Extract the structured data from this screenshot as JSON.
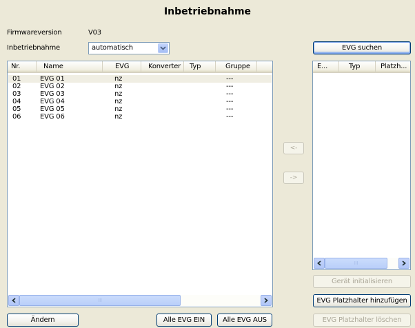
{
  "window": {
    "title": "Inbetriebnahme"
  },
  "firmware": {
    "label": "Firmwareversion",
    "value": "V03"
  },
  "commissioning": {
    "label": "Inbetriebnahme",
    "selected": "automatisch"
  },
  "main_list": {
    "columns": [
      "Nr.",
      "Name",
      "EVG",
      "Konverter",
      "Typ",
      "Gruppe"
    ],
    "rows": [
      {
        "nr": "01",
        "name": "EVG 01",
        "evg": "nz",
        "konverter": "",
        "typ": "",
        "gruppe": "---"
      },
      {
        "nr": "02",
        "name": "EVG 02",
        "evg": "nz",
        "konverter": "",
        "typ": "",
        "gruppe": "---"
      },
      {
        "nr": "03",
        "name": "EVG 03",
        "evg": "nz",
        "konverter": "",
        "typ": "",
        "gruppe": "---"
      },
      {
        "nr": "04",
        "name": "EVG 04",
        "evg": "nz",
        "konverter": "",
        "typ": "",
        "gruppe": "---"
      },
      {
        "nr": "05",
        "name": "EVG 05",
        "evg": "nz",
        "konverter": "",
        "typ": "",
        "gruppe": "---"
      },
      {
        "nr": "06",
        "name": "EVG 06",
        "evg": "nz",
        "konverter": "",
        "typ": "",
        "gruppe": "---"
      }
    ],
    "scroll_thumb_glyph": "III"
  },
  "side_list": {
    "columns": [
      "E...",
      "Typ",
      "Platzh..."
    ],
    "scroll_thumb_glyph": "III"
  },
  "transfer": {
    "left_label": "<-",
    "right_label": "->"
  },
  "buttons": {
    "search": "EVG suchen",
    "init": "Gerät initialisieren",
    "add_placeholder": "EVG Platzhalter hinzufügen",
    "delete_placeholder": "EVG Platzhalter löschen",
    "change": "Ändern",
    "all_on": "Alle EVG EIN",
    "all_off": "Alle EVG AUS"
  },
  "icons": {
    "dropdown": "chevron-down-icon",
    "scroll_left": "arrow-left-icon",
    "scroll_right": "arrow-right-icon"
  },
  "colors": {
    "background": "#ece9d8",
    "list_border": "#7f9db9",
    "button_border": "#003c74",
    "disabled_text": "#aca899",
    "selected_row": "#f0eee3"
  }
}
